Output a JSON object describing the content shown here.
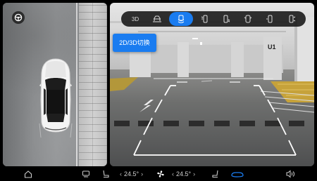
{
  "camera_view": {
    "switch_button_label": "2D/3D切换",
    "modes": [
      {
        "id": "3d",
        "label": "3D",
        "icon": "3d-view",
        "active": false
      },
      {
        "id": "front-wide",
        "label": "",
        "icon": "car-front-icon",
        "active": false
      },
      {
        "id": "rear",
        "label": "",
        "icon": "car-rear-camera-icon",
        "active": true
      },
      {
        "id": "left-front",
        "label": "",
        "icon": "car-left-front-icon",
        "active": false
      },
      {
        "id": "left-rear",
        "label": "",
        "icon": "car-left-rear-icon",
        "active": false
      },
      {
        "id": "right-front",
        "label": "",
        "icon": "car-right-front-icon",
        "active": false
      },
      {
        "id": "right-rear",
        "label": "",
        "icon": "car-right-rear-icon",
        "active": false
      },
      {
        "id": "side",
        "label": "",
        "icon": "car-side-icon",
        "active": false
      }
    ],
    "pillar_label": "U1"
  },
  "bottom_bar": {
    "left_temp": "24.5°",
    "right_temp": "24.5°",
    "left_temp_down": "‹",
    "left_temp_up": "›",
    "right_temp_down": "‹",
    "right_temp_up": "›"
  },
  "colors": {
    "accent": "#1a7cf0",
    "guide_line": "#ffffff"
  }
}
